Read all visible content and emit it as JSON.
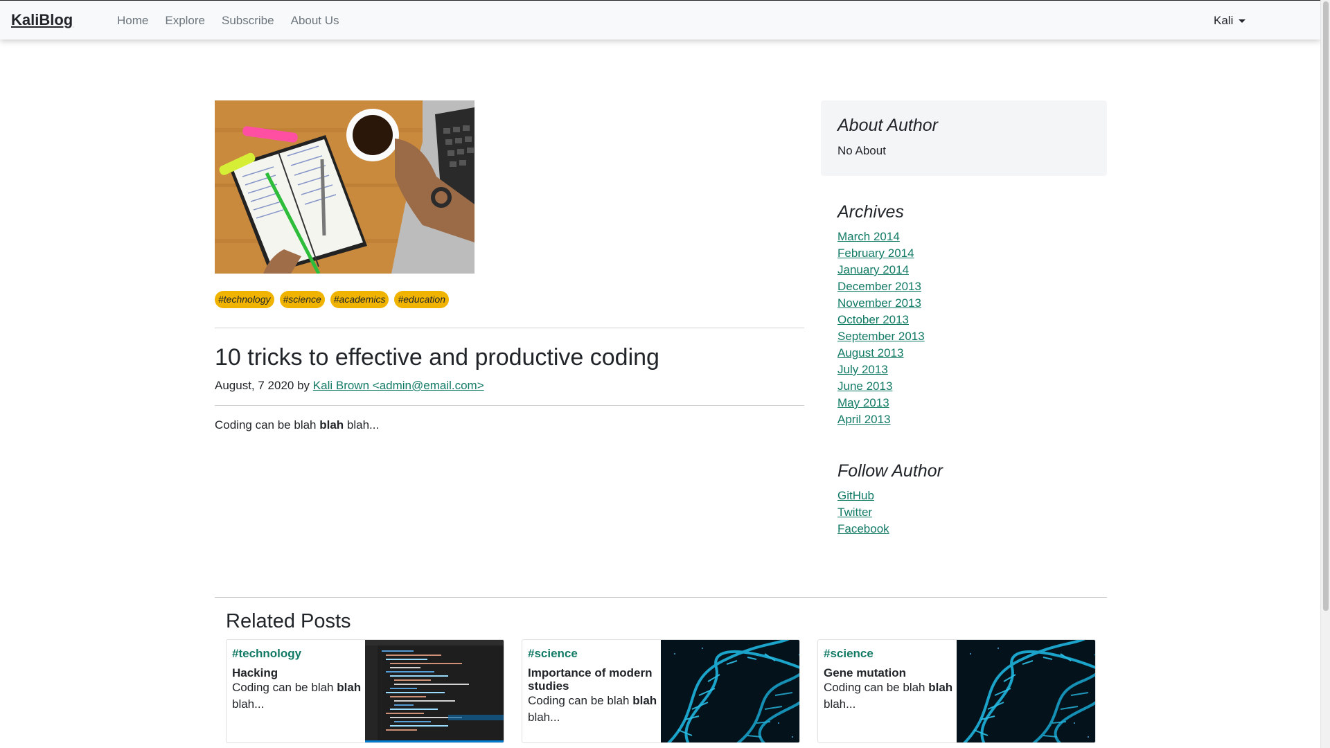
{
  "navbar": {
    "brand": "KaliBlog",
    "links": [
      "Home",
      "Explore",
      "Subscribe",
      "About Us"
    ],
    "user": "Kali"
  },
  "post": {
    "tags": [
      "#technology",
      "#science",
      "#academics",
      "#education"
    ],
    "title": "10 tricks to effective and productive coding",
    "date_by": "August, 7 2020 by",
    "author_link": "Kali Brown <admin@email.com>",
    "body_prefix": "Coding can be blah ",
    "body_bold": "blah",
    "body_suffix": " blah..."
  },
  "sidebar": {
    "about_heading": "About Author",
    "about_text": "No About",
    "archives_heading": "Archives",
    "archives": [
      "March 2014",
      "February 2014",
      "January 2014",
      "December 2013",
      "November 2013",
      "October 2013",
      "September 2013",
      "August 2013",
      "July 2013",
      "June 2013",
      "May 2013",
      "April 2013"
    ],
    "follow_heading": "Follow Author",
    "follow": [
      "GitHub",
      "Twitter",
      "Facebook"
    ]
  },
  "related": {
    "heading": "Related Posts",
    "cards": [
      {
        "category": "#technology",
        "title": "Hacking",
        "desc_prefix": "Coding can be blah ",
        "desc_bold": "blah",
        "desc_suffix": " blah..."
      },
      {
        "category": "#science",
        "title": "Importance of modern studies",
        "desc_prefix": "Coding can be blah ",
        "desc_bold": "blah",
        "desc_suffix": " blah..."
      },
      {
        "category": "#science",
        "title": "Gene mutation",
        "desc_prefix": "Coding can be blah ",
        "desc_bold": "blah",
        "desc_suffix": " blah..."
      }
    ]
  },
  "colors": {
    "accent_link": "#117a65",
    "tag_bg": "#f0b400",
    "navbar_bg": "#f8f9fa"
  }
}
